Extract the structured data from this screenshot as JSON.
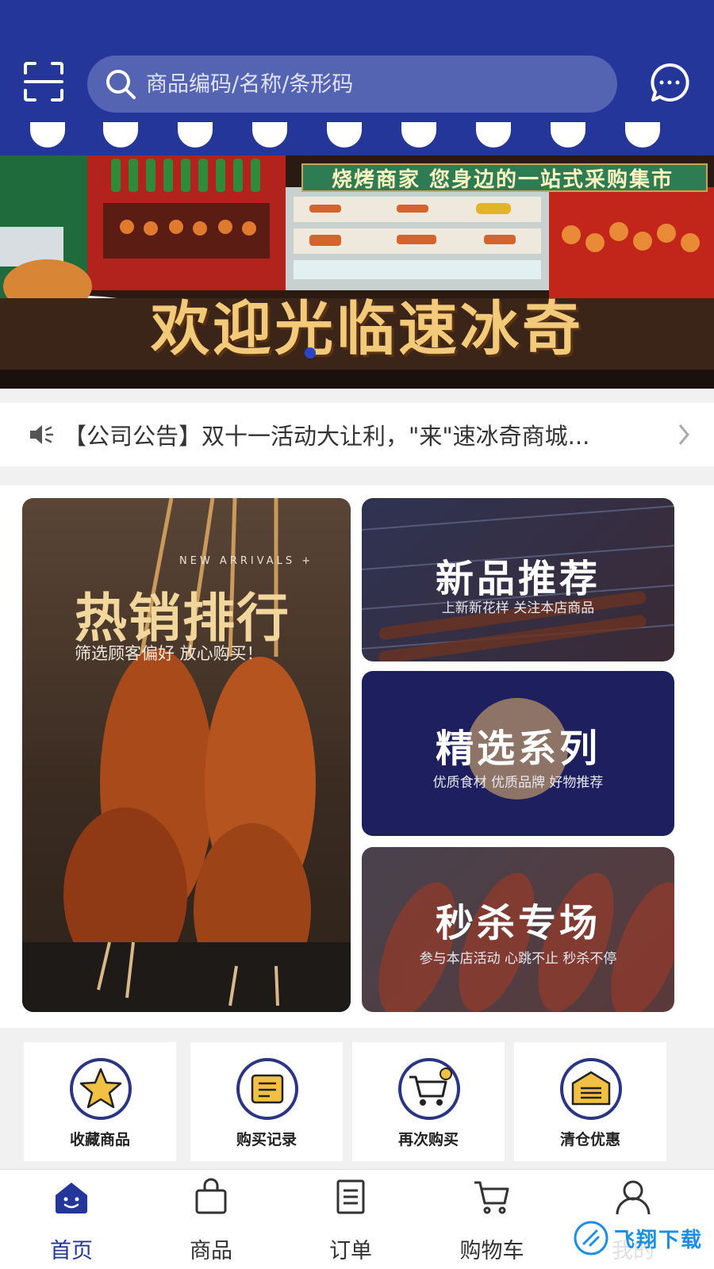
{
  "colors": {
    "primary": "#24369a",
    "gold": "#f3c97a",
    "card_navy": "#1d1f5f"
  },
  "header": {
    "search_placeholder": "商品编码/名称/条形码",
    "icons": {
      "scan": "scan-icon",
      "search": "search-icon",
      "message": "chat-bubble-icon"
    }
  },
  "banner": {
    "tagline": "烧烤商家 您身边的一站式采购集市",
    "title": "欢迎光临速冰奇"
  },
  "notice": {
    "text": "【公司公告】双十一活动大让利，\"来\"速冰奇商城...",
    "icon": "speaker-icon"
  },
  "promos": {
    "hot": {
      "en": "NEW ARRIVALS +",
      "title": "热销排行",
      "subtitle": "筛选顾客偏好 放心购买！"
    },
    "new": {
      "title": "新品推荐",
      "subtitle": "上新新花样 关注本店商品"
    },
    "selected": {
      "title": "精选系列",
      "subtitle": "优质食材 优质品牌 好物推荐"
    },
    "seckill": {
      "title": "秒杀专场",
      "subtitle": "参与本店活动 心跳不止 秒杀不停"
    }
  },
  "shortcuts": [
    {
      "label": "收藏商品",
      "icon": "star-icon"
    },
    {
      "label": "购买记录",
      "icon": "scroll-icon"
    },
    {
      "label": "再次购买",
      "icon": "cart-add-icon"
    },
    {
      "label": "清仓优惠",
      "icon": "warehouse-icon"
    }
  ],
  "nav": [
    {
      "label": "首页",
      "icon": "home-icon",
      "active": true
    },
    {
      "label": "商品",
      "icon": "bag-icon"
    },
    {
      "label": "订单",
      "icon": "order-list-icon"
    },
    {
      "label": "购物车",
      "icon": "cart-icon"
    },
    {
      "label": "我的",
      "icon": "user-icon"
    }
  ],
  "watermark": {
    "text": "飞翔下载"
  }
}
